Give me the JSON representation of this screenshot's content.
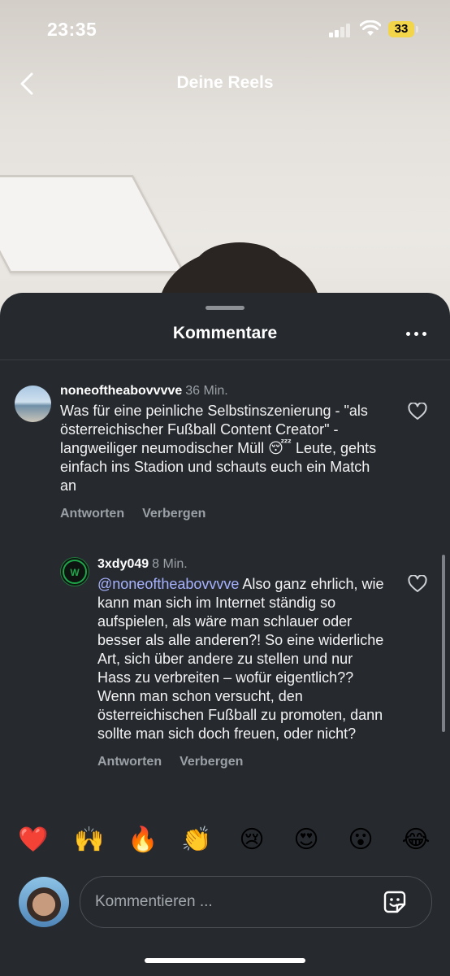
{
  "status_bar": {
    "time": "23:35",
    "battery": "33"
  },
  "header": {
    "title": "Deine Reels"
  },
  "sheet": {
    "title": "Kommentare"
  },
  "comments": [
    {
      "username": "noneoftheabovvvve",
      "time": "36 Min.",
      "text": "Was für eine peinliche Selbstinszenierung - \"als österreichischer Fußball Content Creator\" - langweiliger neumodischer Müll 😴 Leute, gehts einfach ins Stadion und schauts euch ein Match an",
      "reply_label": "Antworten",
      "hide_label": "Verbergen"
    },
    {
      "username": "3xdy049",
      "time": "8 Min.",
      "mention": "@noneoftheabovvvve",
      "text": " Also ganz ehrlich, wie kann man sich im Internet ständig so aufspielen, als wäre man schlauer oder besser als alle anderen?! So eine widerliche Art, sich über andere zu stellen und nur Hass zu verbreiten – wofür eigentlich?? Wenn man schon versucht, den österreichischen Fußball zu promoten, dann sollte man sich doch freuen, oder nicht?",
      "reply_label": "Antworten",
      "hide_label": "Verbergen"
    }
  ],
  "emoji_bar": [
    "❤️",
    "🙌",
    "🔥",
    "👏",
    "😢",
    "😍",
    "😮",
    "😂"
  ],
  "input": {
    "placeholder": "Kommentieren ..."
  },
  "colors": {
    "sheet_bg": "#262a2f",
    "mention": "#a7b2ff",
    "battery": "#f3d54a"
  }
}
